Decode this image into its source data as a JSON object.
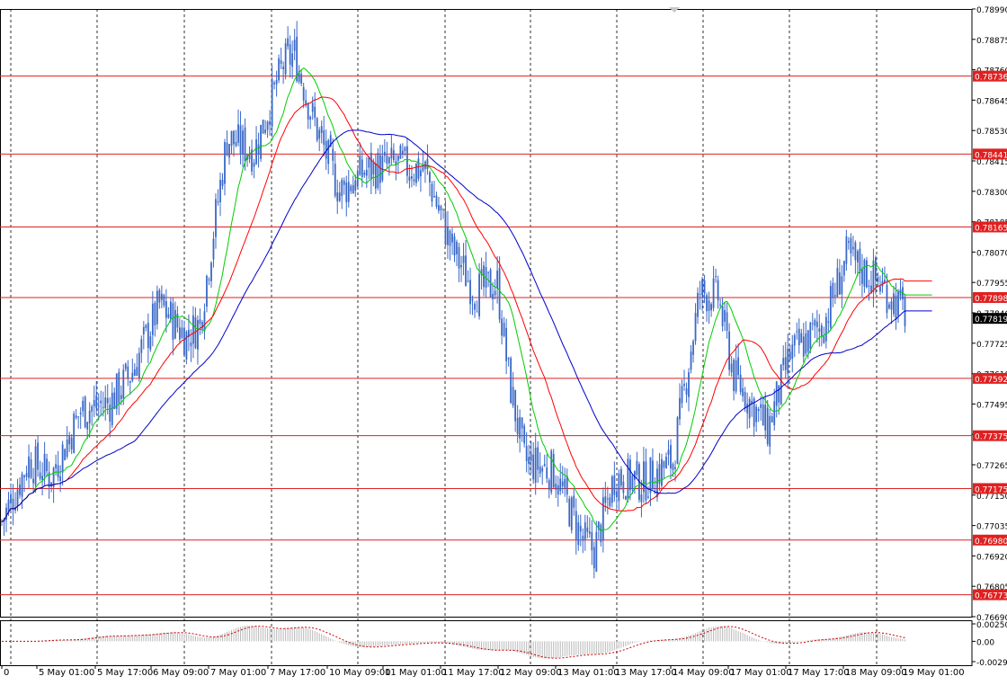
{
  "chart_data": {
    "type": "candlestick",
    "main_price_axis": {
      "ylim": [
        0.7669,
        0.7899
      ],
      "tick_labels": [
        "0.78990",
        "0.78875",
        "0.78760",
        "0.78645",
        "0.78530",
        "0.78415",
        "0.78300",
        "0.78185",
        "0.78070",
        "0.77955",
        "0.77840",
        "0.77725",
        "0.77610",
        "0.77495",
        "0.77380",
        "0.77265",
        "0.77150",
        "0.77035",
        "0.76920",
        "0.76805",
        "0.76690"
      ],
      "tick_values": [
        0.7899,
        0.78875,
        0.7876,
        0.78645,
        0.7853,
        0.78415,
        0.783,
        0.78185,
        0.7807,
        0.77955,
        0.7784,
        0.77725,
        0.7761,
        0.77495,
        0.7738,
        0.77265,
        0.7715,
        0.77035,
        0.7692,
        0.76805,
        0.7669
      ]
    },
    "horizontal_levels": [
      {
        "label": "0.78736",
        "value": 0.78736
      },
      {
        "label": "0.78441",
        "value": 0.78441
      },
      {
        "label": "0.78165",
        "value": 0.78165
      },
      {
        "label": "0.77898",
        "value": 0.77898
      },
      {
        "label": "0.77592",
        "value": 0.77592
      },
      {
        "label": "0.77375",
        "value": 0.77375
      },
      {
        "label": "0.77175",
        "value": 0.77175
      },
      {
        "label": "0.76980",
        "value": 0.7698
      },
      {
        "label": "0.76773",
        "value": 0.76773
      }
    ],
    "current_price": {
      "label": "0.77819",
      "value": 0.77819
    },
    "x_axis_labels": [
      "0",
      "5 May 01:00",
      "5 May 17:00",
      "6 May 09:00",
      "7 May 01:00",
      "7 May 17:00",
      "10 May 09:00",
      "11 May 01:00",
      "11 May 17:00",
      "12 May 09:00",
      "13 May 01:00",
      "13 May 17:00",
      "14 May 09:00",
      "17 May 01:00",
      "17 May 17:00",
      "18 May 09:00",
      "19 May 01:00"
    ],
    "anchors": [
      {
        "t": 0,
        "v": 0.7705
      },
      {
        "t": 12,
        "v": 0.7728
      },
      {
        "t": 22,
        "v": 0.7722
      },
      {
        "t": 35,
        "v": 0.7747
      },
      {
        "t": 48,
        "v": 0.775
      },
      {
        "t": 58,
        "v": 0.7762
      },
      {
        "t": 70,
        "v": 0.7787
      },
      {
        "t": 82,
        "v": 0.7775
      },
      {
        "t": 88,
        "v": 0.778
      },
      {
        "t": 100,
        "v": 0.785
      },
      {
        "t": 112,
        "v": 0.7845
      },
      {
        "t": 125,
        "v": 0.7878
      },
      {
        "t": 130,
        "v": 0.7882
      },
      {
        "t": 138,
        "v": 0.7858
      },
      {
        "t": 150,
        "v": 0.783
      },
      {
        "t": 162,
        "v": 0.7838
      },
      {
        "t": 175,
        "v": 0.784
      },
      {
        "t": 188,
        "v": 0.7838
      },
      {
        "t": 200,
        "v": 0.7808
      },
      {
        "t": 210,
        "v": 0.7792
      },
      {
        "t": 220,
        "v": 0.7795
      },
      {
        "t": 225,
        "v": 0.776
      },
      {
        "t": 232,
        "v": 0.7728
      },
      {
        "t": 245,
        "v": 0.7724
      },
      {
        "t": 258,
        "v": 0.7698
      },
      {
        "t": 263,
        "v": 0.7694
      },
      {
        "t": 272,
        "v": 0.7722
      },
      {
        "t": 285,
        "v": 0.772
      },
      {
        "t": 298,
        "v": 0.7728
      },
      {
        "t": 310,
        "v": 0.7792
      },
      {
        "t": 318,
        "v": 0.779
      },
      {
        "t": 325,
        "v": 0.776
      },
      {
        "t": 340,
        "v": 0.774
      },
      {
        "t": 350,
        "v": 0.7768
      },
      {
        "t": 365,
        "v": 0.778
      },
      {
        "t": 375,
        "v": 0.7805
      },
      {
        "t": 390,
        "v": 0.7795
      },
      {
        "t": 402,
        "v": 0.7783
      }
    ],
    "moving_averages": [
      {
        "color": "#00cc00",
        "period": 5
      },
      {
        "color": "#ff0000",
        "period": 10
      },
      {
        "color": "#0000cc",
        "period": 20
      }
    ],
    "oscillator": {
      "tick_labels": [
        "0.002505",
        "0.00",
        "-0.00292"
      ],
      "tick_values": [
        0.002505,
        0.0,
        -0.00292
      ],
      "ylim": [
        -0.00292,
        0.002505
      ]
    },
    "colors": {
      "candle": "#3a68c8",
      "level_line": "#e02020",
      "level_label_bg": "#e02020",
      "current_label_bg": "#000000",
      "grid": "#000000",
      "osc_line": "#cc0000",
      "osc_hist": "#b8b8b8"
    }
  }
}
